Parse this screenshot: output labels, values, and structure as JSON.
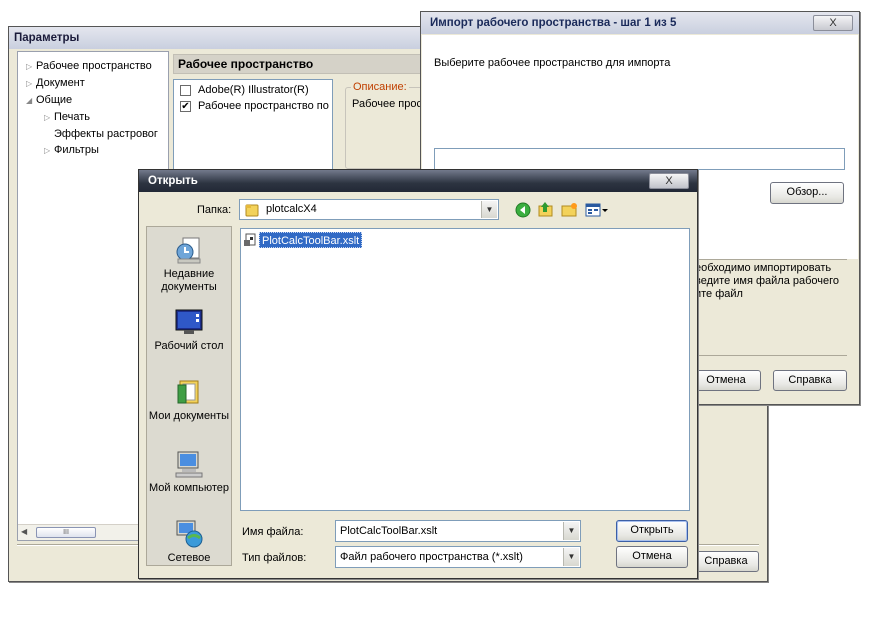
{
  "params": {
    "title": "Параметры",
    "tree": [
      {
        "label": "Рабочее пространство",
        "level": 0,
        "expander": "▷"
      },
      {
        "label": "Документ",
        "level": 0,
        "expander": "▷"
      },
      {
        "label": "Общие",
        "level": 0,
        "expander": "◢"
      },
      {
        "label": "Печать",
        "level": 1,
        "expander": "▷"
      },
      {
        "label": "Эффекты растровог",
        "level": 1,
        "expander": ""
      },
      {
        "label": "Фильтры",
        "level": 1,
        "expander": "▷"
      }
    ],
    "scroll_label": "III",
    "section_title": "Рабочее пространство",
    "list": [
      {
        "label": "Adobe(R) Illustrator(R)",
        "checked": false
      },
      {
        "label": "Рабочее пространство по",
        "checked": true
      }
    ],
    "desc_label": "Описание:",
    "desc_text": "Рабочее простр",
    "help": "Справка"
  },
  "import": {
    "title": "Импорт рабочего пространства - шаг 1 из 5",
    "close": "X",
    "prompt": "Выберите рабочее пространство для импорта",
    "path_value": "",
    "browse": "Обзор...",
    "info_lines": [
      "еобходимо импортировать",
      "ведите имя файла рабочего",
      "ите файл"
    ],
    "cancel": "Отмена",
    "help": "Справка"
  },
  "open": {
    "title": "Открыть",
    "close": "X",
    "folder_label": "Папка:",
    "folder_value": "plotcalcX4",
    "places": [
      {
        "label": "Недавние документы",
        "icon": "recent-documents-icon"
      },
      {
        "label": "Рабочий стол",
        "icon": "desktop-icon"
      },
      {
        "label": "Мои документы",
        "icon": "my-documents-icon"
      },
      {
        "label": "Мой компьютер",
        "icon": "my-computer-icon"
      },
      {
        "label": "Сетевое",
        "icon": "network-icon"
      }
    ],
    "files": [
      {
        "name": "PlotCalcToolBar.xslt",
        "selected": true
      }
    ],
    "filename_label": "Имя файла:",
    "filename_value": "PlotCalcToolBar.xslt",
    "filetype_label": "Тип файлов:",
    "filetype_value": "Файл рабочего пространства (*.xslt)",
    "open_btn": "Открыть",
    "cancel_btn": "Отмена"
  }
}
